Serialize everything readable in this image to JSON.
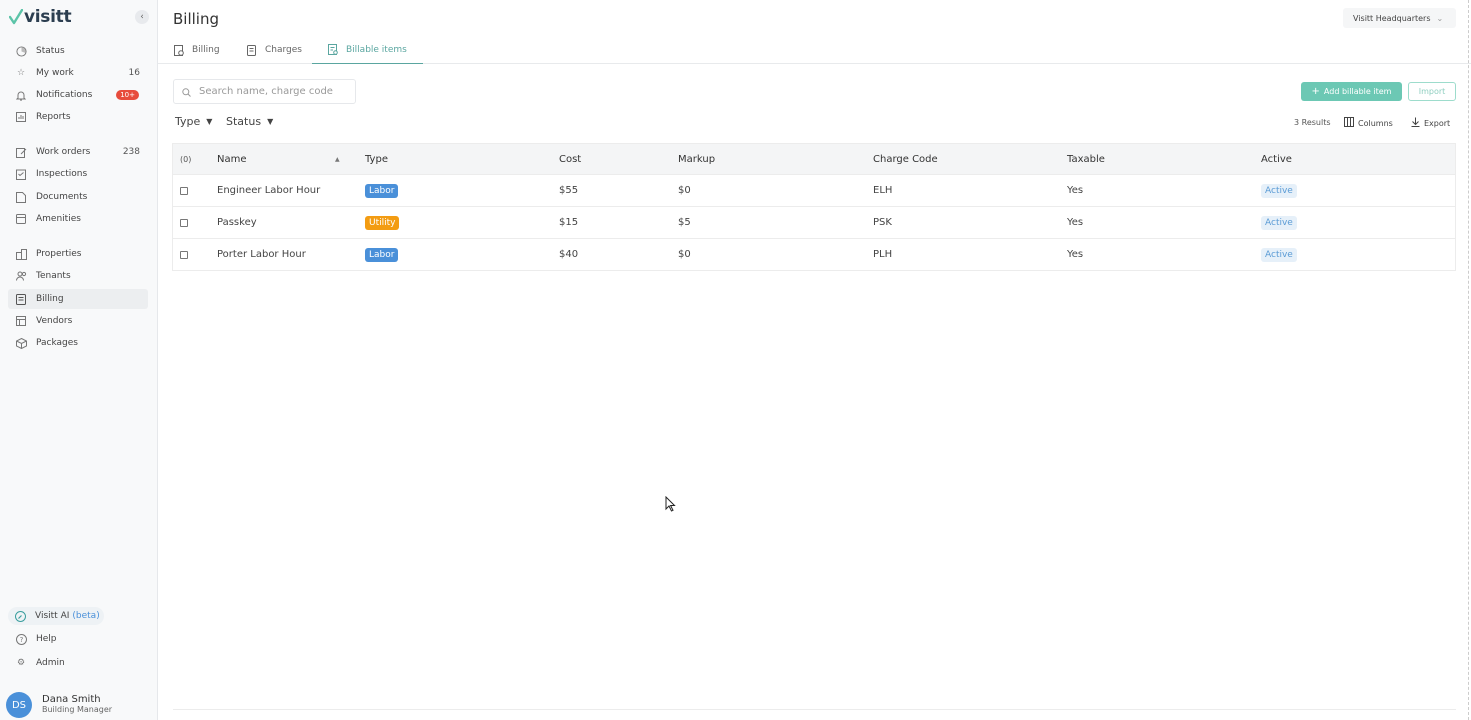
{
  "app": {
    "logo": "visitt"
  },
  "sidebar": {
    "items": [
      {
        "label": "Status",
        "icon": "status-icon"
      },
      {
        "label": "My work",
        "icon": "star-icon",
        "count": "16"
      },
      {
        "label": "Notifications",
        "icon": "bell-icon",
        "badge": "10+"
      },
      {
        "label": "Reports",
        "icon": "reports-icon"
      },
      {
        "label": "Work orders",
        "icon": "work-orders-icon",
        "count": "238"
      },
      {
        "label": "Inspections",
        "icon": "inspections-icon"
      },
      {
        "label": "Documents",
        "icon": "documents-icon"
      },
      {
        "label": "Amenities",
        "icon": "amenities-icon"
      },
      {
        "label": "Properties",
        "icon": "properties-icon"
      },
      {
        "label": "Tenants",
        "icon": "tenants-icon"
      },
      {
        "label": "Billing",
        "icon": "billing-icon"
      },
      {
        "label": "Vendors",
        "icon": "vendors-icon"
      },
      {
        "label": "Packages",
        "icon": "packages-icon"
      }
    ],
    "ai": {
      "label": "Visitt AI",
      "tag": "(beta)"
    },
    "bottom": [
      {
        "label": "Help",
        "icon": "help-icon"
      },
      {
        "label": "Admin",
        "icon": "gear-icon"
      }
    ],
    "user": {
      "initials": "DS",
      "name": "Dana Smith",
      "role": "Building Manager"
    }
  },
  "header": {
    "title": "Billing",
    "location": "Visitt Headquarters"
  },
  "tabs": [
    {
      "label": "Billing"
    },
    {
      "label": "Charges"
    },
    {
      "label": "Billable items"
    }
  ],
  "toolbar": {
    "search_placeholder": "Search name, charge code",
    "add_label": "Add billable item",
    "import_label": "Import",
    "filter_type": "Type",
    "filter_status": "Status",
    "results": "3 Results",
    "columns_label": "Columns",
    "export_label": "Export"
  },
  "table": {
    "selected_count": "(0)",
    "headers": [
      "Name",
      "Type",
      "Cost",
      "Markup",
      "Charge Code",
      "Taxable",
      "Active"
    ],
    "rows": [
      {
        "name": "Engineer Labor Hour",
        "type": "Labor",
        "cost": "$55",
        "markup": "$0",
        "code": "ELH",
        "taxable": "Yes",
        "active": "Active"
      },
      {
        "name": "Passkey",
        "type": "Utility",
        "cost": "$15",
        "markup": "$5",
        "code": "PSK",
        "taxable": "Yes",
        "active": "Active"
      },
      {
        "name": "Porter Labor Hour",
        "type": "Labor",
        "cost": "$40",
        "markup": "$0",
        "code": "PLH",
        "taxable": "Yes",
        "active": "Active"
      }
    ]
  },
  "colors": {
    "accent": "#5aa6a0",
    "labor_tag": "#4a90d9",
    "utility_tag": "#f39c12",
    "add_button": "#6cc8b4",
    "badge": "#e74c3c"
  }
}
